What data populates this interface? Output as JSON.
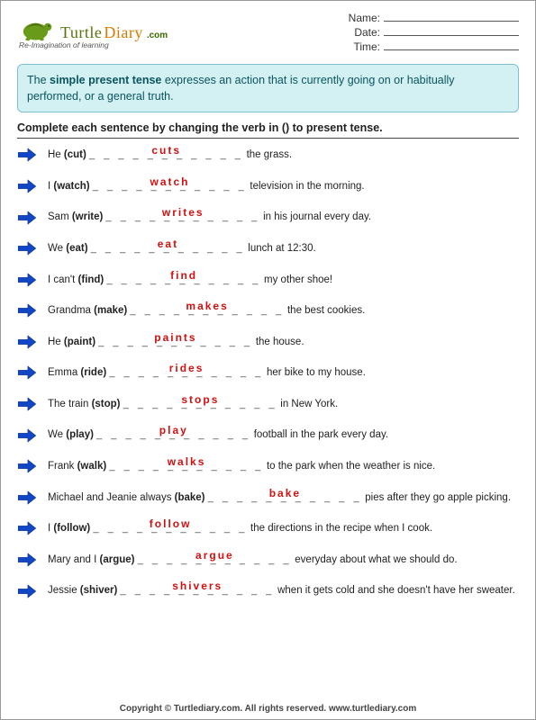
{
  "logo": {
    "word1": "Turtle",
    "word2": "Diary",
    "com": ".com",
    "sub": "Re-Imagination of learning"
  },
  "meta": {
    "name_label": "Name:",
    "date_label": "Date:",
    "time_label": "Time:"
  },
  "explain_pre": "The ",
  "explain_bold": "simple present tense",
  "explain_post": " expresses an action that is currently going on or habitually performed, or a general truth.",
  "instruction": "Complete each sentence by changing the verb in () to present tense.",
  "questions": [
    {
      "pre": "He ",
      "verb": "(cut)",
      "answer": "cuts",
      "post": " the grass."
    },
    {
      "pre": "I ",
      "verb": "(watch)",
      "answer": "watch",
      "post": " television in the morning."
    },
    {
      "pre": "Sam ",
      "verb": "(write)",
      "answer": "writes",
      "post": " in his journal every day."
    },
    {
      "pre": "We ",
      "verb": "(eat)",
      "answer": "eat",
      "post": "  lunch at 12:30."
    },
    {
      "pre": "I can't ",
      "verb": "(find)",
      "answer": "find",
      "post": " my other shoe!"
    },
    {
      "pre": "Grandma ",
      "verb": "(make)",
      "answer": "makes",
      "post": " the best cookies."
    },
    {
      "pre": "He ",
      "verb": "(paint)",
      "answer": "paints",
      "post": " the house."
    },
    {
      "pre": "Emma ",
      "verb": "(ride)",
      "answer": "rides",
      "post": " her bike to my house."
    },
    {
      "pre": "The train ",
      "verb": "(stop)",
      "answer": "stops",
      "post": " in New York."
    },
    {
      "pre": "We ",
      "verb": "(play)",
      "answer": "play",
      "post": " football in the park every day."
    },
    {
      "pre": "Frank ",
      "verb": "(walk)",
      "answer": "walks",
      "post": " to the park when the weather is nice."
    },
    {
      "pre": "Michael and Jeanie always ",
      "verb": "(bake)",
      "answer": "bake",
      "post": " pies after they go apple picking."
    },
    {
      "pre": "I ",
      "verb": "(follow)",
      "answer": "follow",
      "post": " the directions in the recipe when I cook."
    },
    {
      "pre": "Mary and I ",
      "verb": "(argue)",
      "answer": "argue",
      "post": " everyday about what we should do."
    },
    {
      "pre": "Jessie ",
      "verb": "(shiver)",
      "answer": "shivers",
      "post": " when it gets cold and she doesn't have her sweater."
    }
  ],
  "footer": "Copyright © Turtlediary.com. All rights reserved. www.turtlediary.com"
}
